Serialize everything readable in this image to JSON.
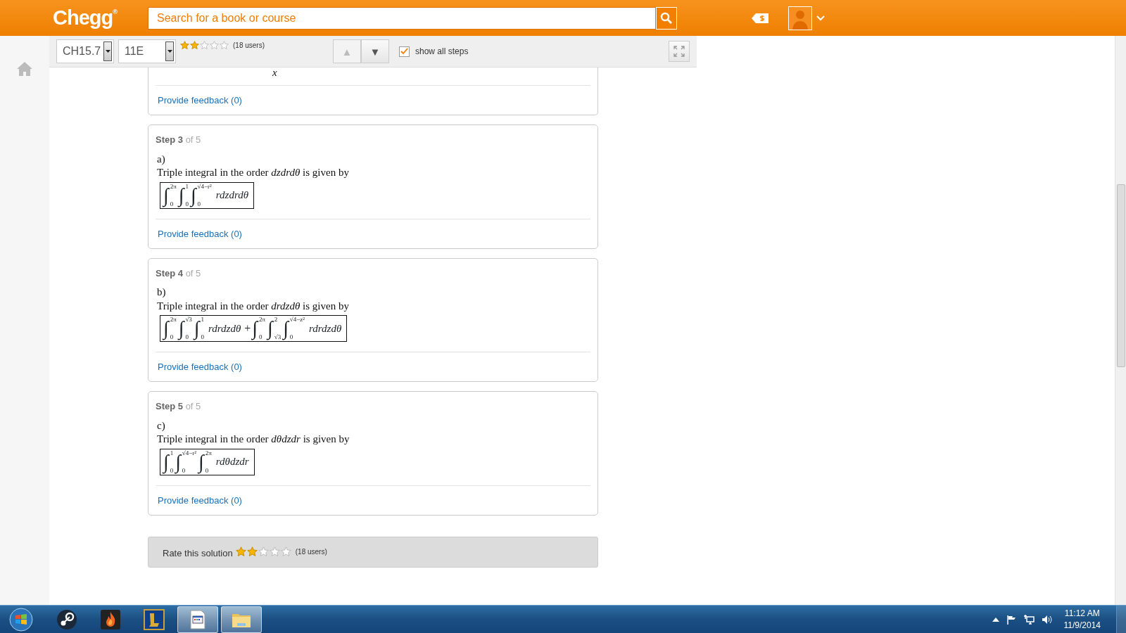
{
  "header": {
    "logo": "Chegg",
    "logo_mark": "®",
    "search": {
      "placeholder": "Search for a book or course"
    }
  },
  "toolbar": {
    "chapter": "CH15.7",
    "problem": "11E",
    "rating": {
      "stars": 2,
      "count": "(18 users)"
    },
    "nav": [
      {
        "glyph": "▲",
        "disabled": true
      },
      {
        "glyph": "▼",
        "disabled": false
      }
    ],
    "show_all_steps": {
      "label": "show all steps",
      "checked": true
    }
  },
  "integral_sign": "∫",
  "partial_step": {
    "fragment": "x",
    "feedback": "Provide feedback (0)"
  },
  "steps": [
    {
      "title": "Step 3",
      "of": "of 5",
      "part": "a)",
      "text": "Triple integral in the order *dzdrdθ* is given by",
      "formula": [
        {
          "integrals": [
            {
              "upper": "2π",
              "lower": "0"
            },
            {
              "upper": "1",
              "lower": "0"
            },
            {
              "upper": "√4−r²",
              "lower": "0"
            }
          ],
          "integrand": "rdzdrdθ"
        }
      ],
      "feedback": "Provide feedback (0)"
    },
    {
      "title": "Step 4",
      "of": "of 5",
      "part": "b)",
      "text": "Triple integral in the order *drdzdθ* is given by",
      "formula": [
        {
          "integrals": [
            {
              "upper": "2π",
              "lower": "0"
            },
            {
              "upper": "√3",
              "lower": "0"
            },
            {
              "upper": "1",
              "lower": "0"
            }
          ],
          "integrand": "rdrdzdθ"
        },
        {
          "operator": "+",
          "integrals": [
            {
              "upper": "2π",
              "lower": "0"
            },
            {
              "upper": "2",
              "lower": "√3"
            },
            {
              "upper": "√4−z²",
              "lower": "0"
            }
          ],
          "integrand": "rdrdzdθ"
        }
      ],
      "feedback": "Provide feedback (0)"
    },
    {
      "title": "Step 5",
      "of": "of 5",
      "part": "c)",
      "text": "Triple integral in the order *dθdzdr* is given by",
      "formula": [
        {
          "integrals": [
            {
              "upper": "1",
              "lower": "0"
            },
            {
              "upper": "√4−r²",
              "lower": "0"
            },
            {
              "upper": "2π",
              "lower": "0"
            }
          ],
          "integrand": "rdθdzdr"
        }
      ],
      "feedback": "Provide feedback (0)"
    }
  ],
  "rate_bar": {
    "label": "Rate this solution",
    "stars": 2,
    "count": "(18 users)"
  },
  "taskbar": {
    "apps": [
      {
        "kind": "steam",
        "active": false
      },
      {
        "kind": "flame",
        "active": false
      },
      {
        "kind": "emblem",
        "active": false
      },
      {
        "kind": "window",
        "active": true
      },
      {
        "kind": "folder",
        "active": true
      }
    ],
    "tray": {
      "time": "11:12 AM",
      "date": "11/9/2014"
    }
  }
}
